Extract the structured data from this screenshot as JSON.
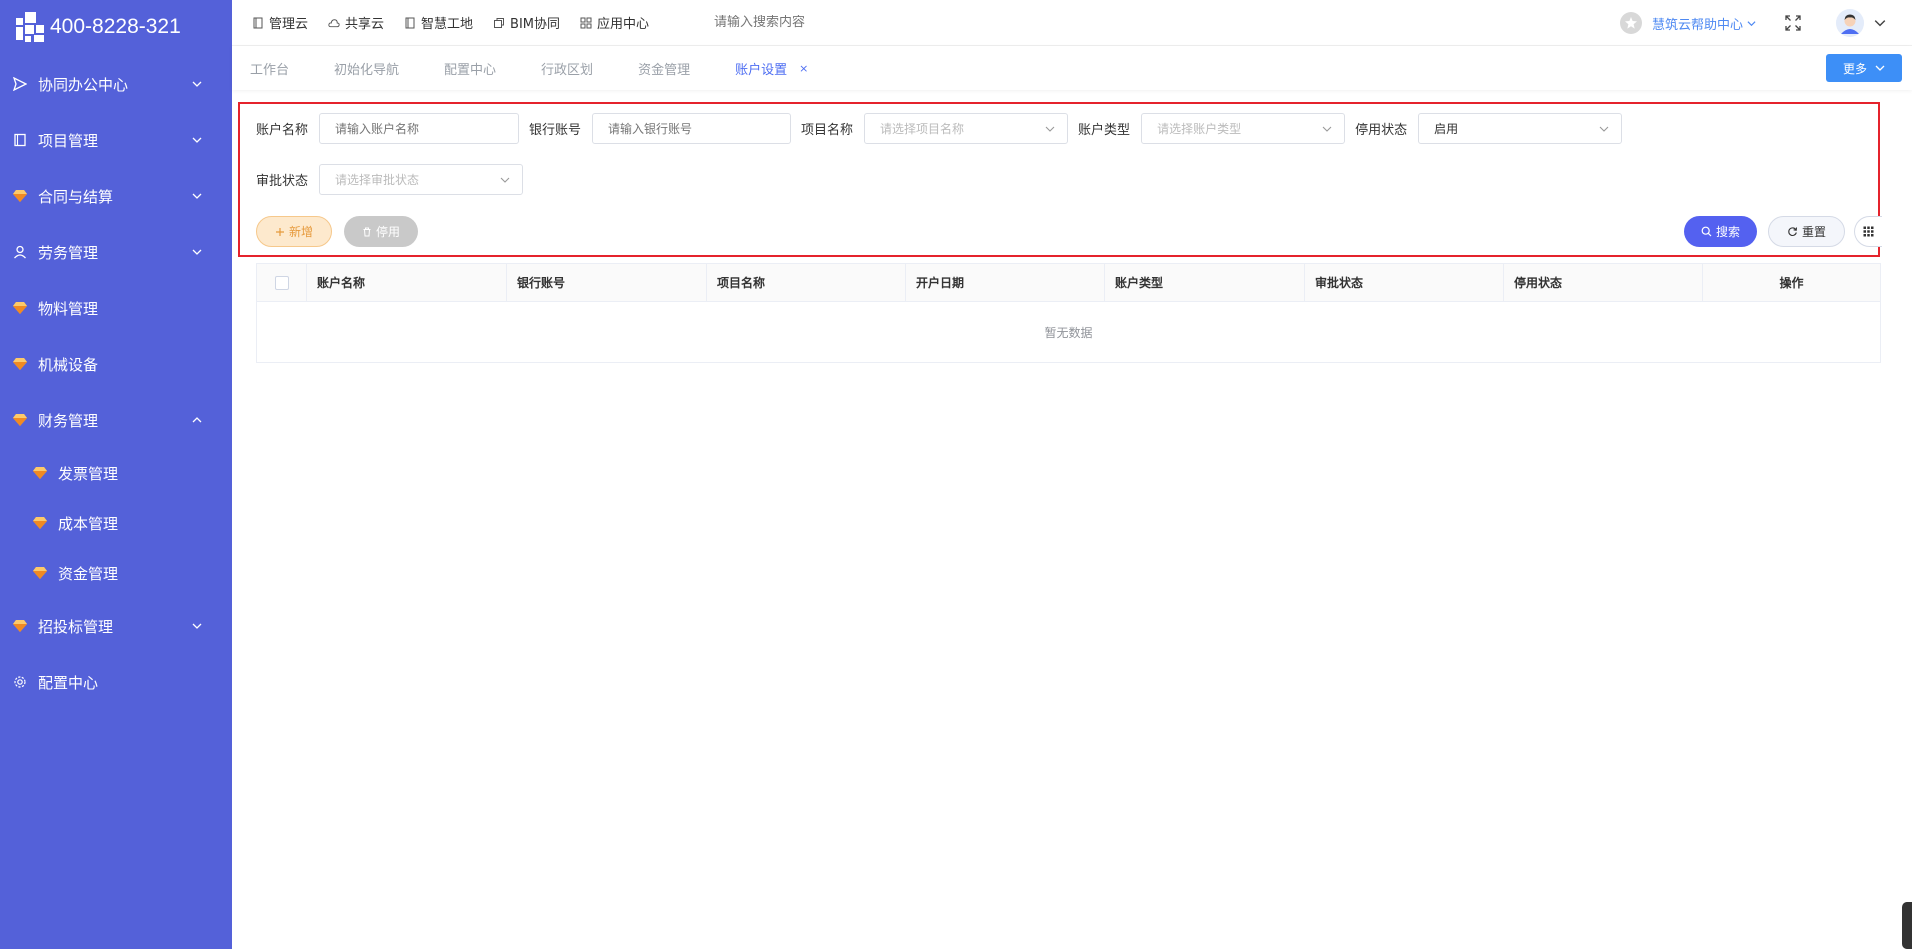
{
  "brand": {
    "phone": "400-8228-321"
  },
  "sidebar": {
    "items": [
      {
        "label": "协同办公中心",
        "icon": "send-icon",
        "expanded": false
      },
      {
        "label": "项目管理",
        "icon": "book-icon",
        "expanded": false
      },
      {
        "label": "合同与结算",
        "icon": "gem-icon",
        "expanded": false
      },
      {
        "label": "劳务管理",
        "icon": "user-icon",
        "expanded": false
      },
      {
        "label": "物料管理",
        "icon": "gem-icon"
      },
      {
        "label": "机械设备",
        "icon": "gem-icon"
      },
      {
        "label": "财务管理",
        "icon": "gem-icon",
        "expanded": true
      },
      {
        "label": "招投标管理",
        "icon": "gem-icon",
        "expanded": false
      },
      {
        "label": "配置中心",
        "icon": "gear-icon"
      }
    ],
    "subitems": [
      {
        "label": "发票管理",
        "icon": "gem-icon"
      },
      {
        "label": "成本管理",
        "icon": "gem-icon"
      },
      {
        "label": "资金管理",
        "icon": "gem-icon"
      }
    ]
  },
  "topbar": {
    "nav": [
      {
        "label": "管理云",
        "icon": "doc-icon"
      },
      {
        "label": "共享云",
        "icon": "cloud-icon"
      },
      {
        "label": "智慧工地",
        "icon": "book-icon"
      },
      {
        "label": "BIM协同",
        "icon": "cube-icon"
      },
      {
        "label": "应用中心",
        "icon": "grid-icon"
      }
    ],
    "search_placeholder": "请输入搜索内容",
    "help_label": "慧筑云帮助中心"
  },
  "tabs": [
    {
      "label": "工作台",
      "active": false
    },
    {
      "label": "初始化导航",
      "active": false
    },
    {
      "label": "配置中心",
      "active": false
    },
    {
      "label": "行政区划",
      "active": false
    },
    {
      "label": "资金管理",
      "active": false
    },
    {
      "label": "账户设置",
      "active": true,
      "close": "×"
    }
  ],
  "more_label": "更多",
  "filter": {
    "account_name_label": "账户名称",
    "account_name_placeholder": "请输入账户名称",
    "bank_account_label": "银行账号",
    "bank_account_placeholder": "请输入银行账号",
    "project_name_label": "项目名称",
    "project_name_placeholder": "请选择项目名称",
    "account_type_label": "账户类型",
    "account_type_placeholder": "请选择账户类型",
    "disable_status_label": "停用状态",
    "disable_status_value": "启用",
    "approval_status_label": "审批状态",
    "approval_status_placeholder": "请选择审批状态"
  },
  "actions": {
    "add_label": "新增",
    "disable_label": "停用",
    "search_label": "搜索",
    "reset_label": "重置"
  },
  "table": {
    "columns": [
      "账户名称",
      "银行账号",
      "项目名称",
      "开户日期",
      "账户类型",
      "审批状态",
      "停用状态",
      "操作"
    ],
    "empty_text": "暂无数据"
  },
  "colors": {
    "sidebar_bg": "#5461d9",
    "accent": "#4e6ef2",
    "highlight_border": "#e5232c",
    "more_button": "#3d8ff7"
  }
}
